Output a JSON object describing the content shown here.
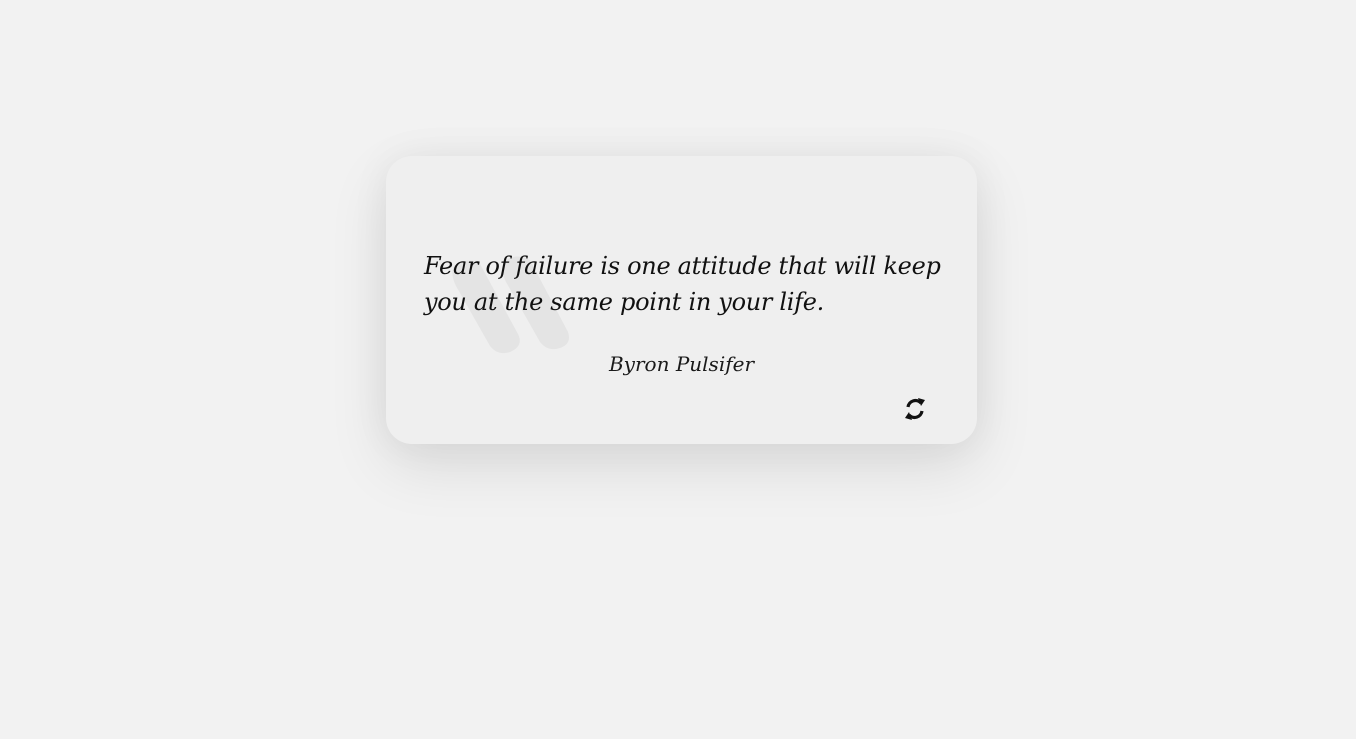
{
  "quote": {
    "text": "Fear of failure is one attitude that will keep you at the same point in your life.",
    "author": "Byron Pulsifer"
  },
  "controls": {
    "refresh_icon": "refresh-icon"
  },
  "colors": {
    "page_background": "#f2f2f2",
    "card_background": "#efefef",
    "text": "#111111",
    "quote_mark": "#e4e4e4"
  }
}
